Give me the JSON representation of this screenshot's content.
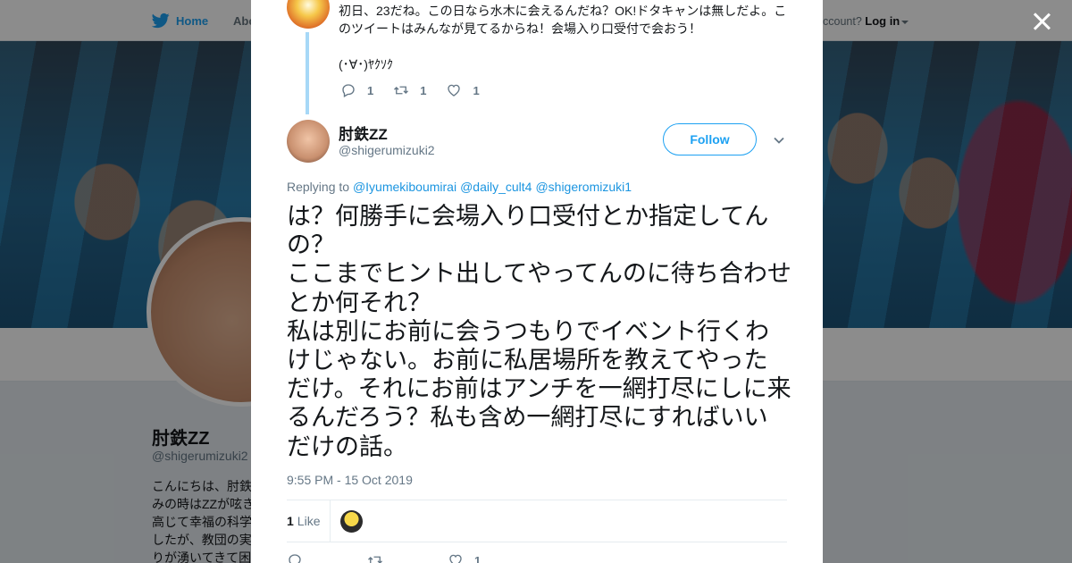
{
  "nav": {
    "home_label": "Home",
    "about_label": "Abo",
    "account_prompt": "ccount?",
    "login_label": "Log in"
  },
  "profile": {
    "name": "肘鉄ZZ",
    "handle": "@shigerumizuki2",
    "bio_lines": [
      "こんにちは、肘鉄",
      "みの時はZZが呟き",
      "高じて幸福の科学",
      "したが、教団の実",
      "りが湧いてきて困"
    ]
  },
  "parent_tweet": {
    "text": "初日、23だね。この日なら水木に会えるんだね？OK!ドタキャンは無しだよ。このツイートはみんなが見てるからね！会場入り口受付で会おう！",
    "kaomoji": "(･∀･)ﾔｸｿｸ",
    "reply_count": "1",
    "retweet_count": "1",
    "like_count": "1"
  },
  "tweet": {
    "author_name": "肘鉄ZZ",
    "author_handle": "@shigerumizuki2",
    "follow_label": "Follow",
    "replying_label": "Replying to",
    "mentions": [
      "@Iyumekiboumirai",
      "@daily_cult4",
      "@shigeromizuki1"
    ],
    "text": "は？何勝手に会場入り口受付とか指定してんの？\nここまでヒント出してやってんのに待ち合わせとか何それ？\n私は別にお前に会うつもりでイベント行くわけじゃない。お前に私居場所を教えてやっただけ。それにお前はアンチを一網打尽にしに来るんだろう？私も含め一網打尽にすればいいだけの話。",
    "timestamp": "9:55 PM - 15 Oct 2019",
    "likes_count": "1",
    "likes_label": "Like",
    "reply_count": "",
    "retweet_count": "",
    "like_count": "1"
  },
  "colors": {
    "accent": "#1da1f2",
    "mention": "#1b95e0",
    "muted": "#657786",
    "thread_line": "#a7d8f7"
  },
  "icons": [
    "twitter-bird-icon",
    "reply-icon",
    "retweet-icon",
    "heart-icon",
    "chevron-down-icon",
    "close-icon"
  ]
}
